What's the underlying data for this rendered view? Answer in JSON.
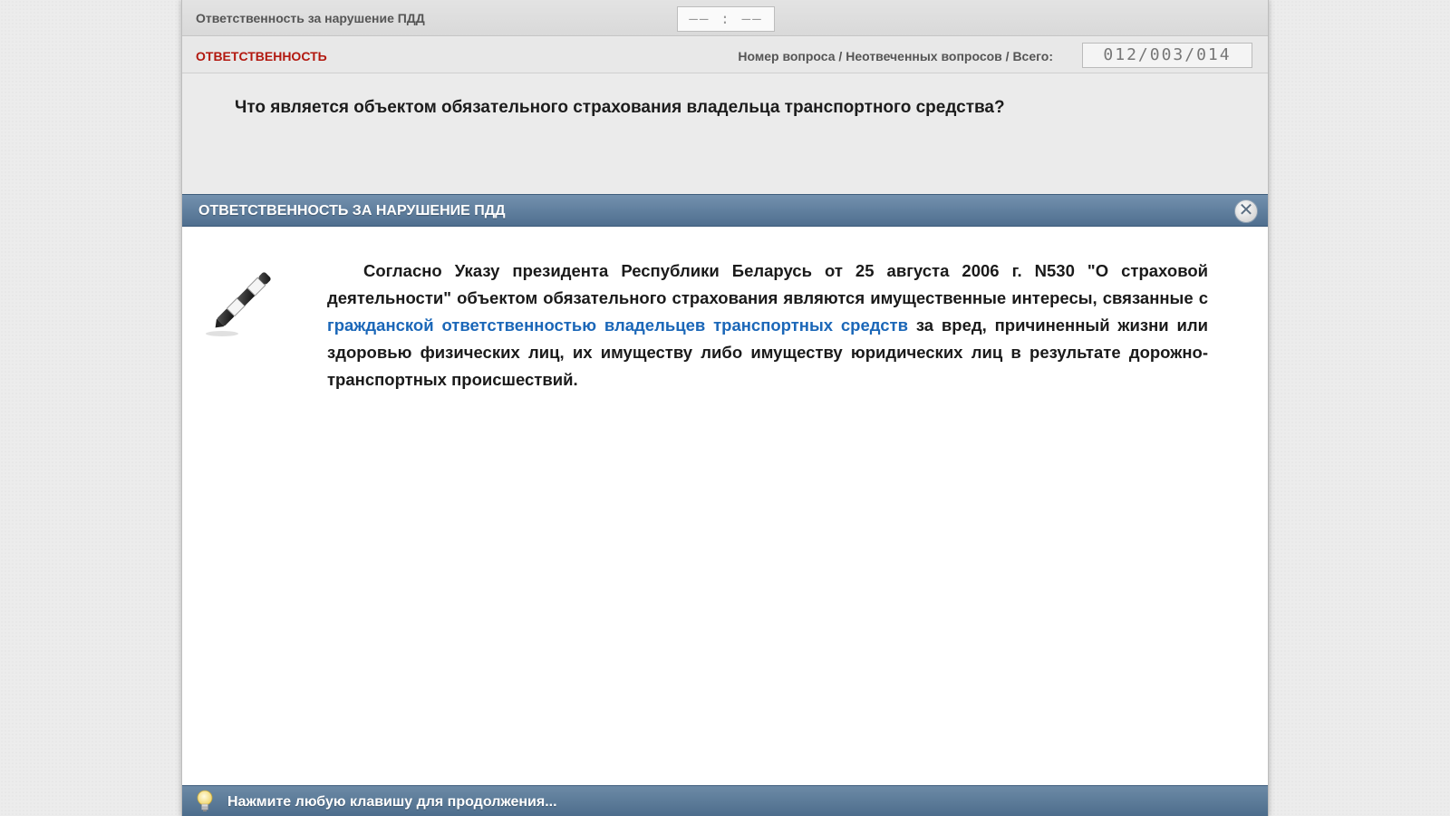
{
  "topbar": {
    "topic_title": "Ответственность за нарушение ПДД",
    "timer": "—— : ——"
  },
  "header": {
    "category": "ОТВЕТСТВЕННОСТЬ",
    "counter_label": "Номер вопроса / Неотвеченных вопросов / Всего:",
    "counter_value": "012/003/014"
  },
  "question": {
    "text": "Что является объектом обязательного страхования владельца транспортного средства?"
  },
  "explanation_panel": {
    "title": "ОТВЕТСТВЕННОСТЬ ЗА НАРУШЕНИЕ ПДД",
    "close_symbol": "✕",
    "text_before_link": "Согласно Указу президента Республики Беларусь от 25 августа 2006 г. N530 \"О страховой деятельности\" объектом обязательного страхования являются имущественные интересы, связанные с ",
    "link_text": "гражданской ответственностью владельцев транспортных средств",
    "text_after_link": " за вред, причиненный жизни или здоровью физических лиц, их имуществу либо имуществу юридических лиц в результате дорожно-транспортных происшествий.",
    "icon": "pen-icon"
  },
  "footer": {
    "hint_icon": "lightbulb-icon",
    "hint_text": "Нажмите любую клавишу для продолжения..."
  },
  "colors": {
    "category_red": "#b2180f",
    "panel_blue": "#5b7b9b",
    "link_blue": "#1b67b8"
  }
}
